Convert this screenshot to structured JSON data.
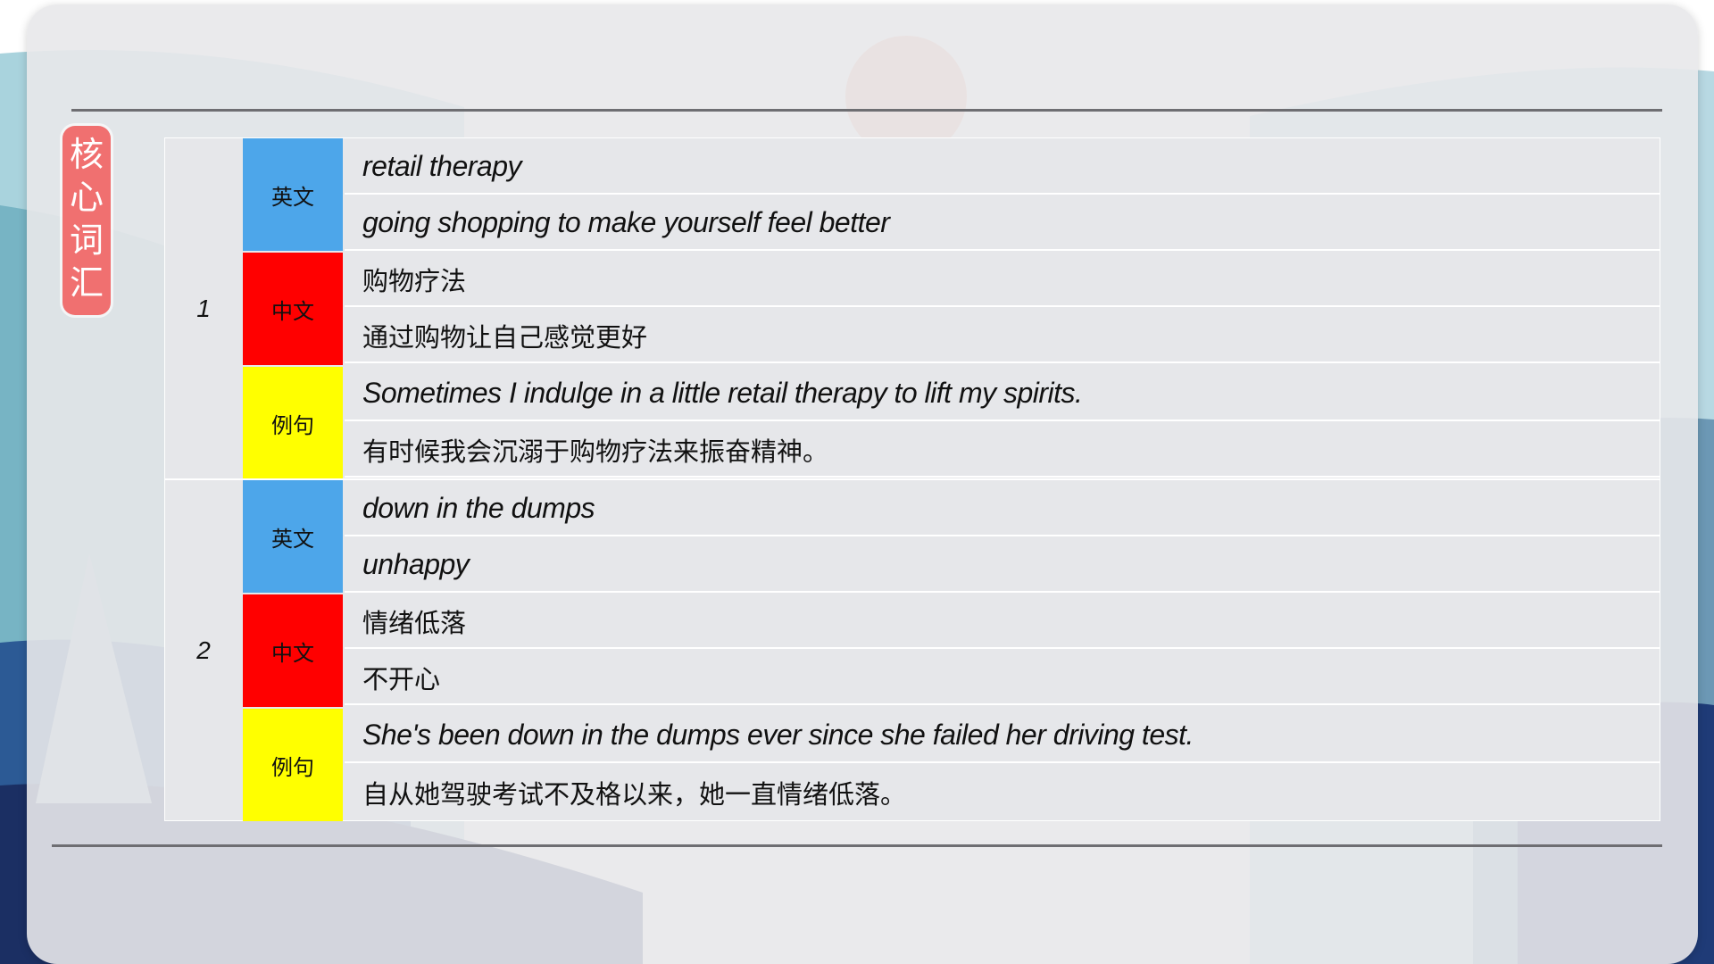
{
  "badge": {
    "chars": [
      "核",
      "心",
      "词",
      "汇"
    ]
  },
  "labels": {
    "english": "英文",
    "chinese": "中文",
    "example": "例句"
  },
  "colors": {
    "english": "#4da6ea",
    "chinese": "#ff0000",
    "example": "#ffff00",
    "badge": "#f07070"
  },
  "entries": [
    {
      "number": "1",
      "english": [
        "retail therapy",
        "going shopping to make yourself feel better"
      ],
      "chinese": [
        "购物疗法",
        "通过购物让自己感觉更好"
      ],
      "example": [
        "Sometimes I indulge in a little retail therapy to lift my spirits.",
        "有时候我会沉溺于购物疗法来振奋精神。"
      ]
    },
    {
      "number": "2",
      "english": [
        "down in the dumps",
        "unhappy"
      ],
      "chinese": [
        "情绪低落",
        "不开心"
      ],
      "example": [
        "She's been down in the dumps ever since she failed her driving test.",
        "自从她驾驶考试不及格以来，她一直情绪低落。"
      ]
    }
  ]
}
